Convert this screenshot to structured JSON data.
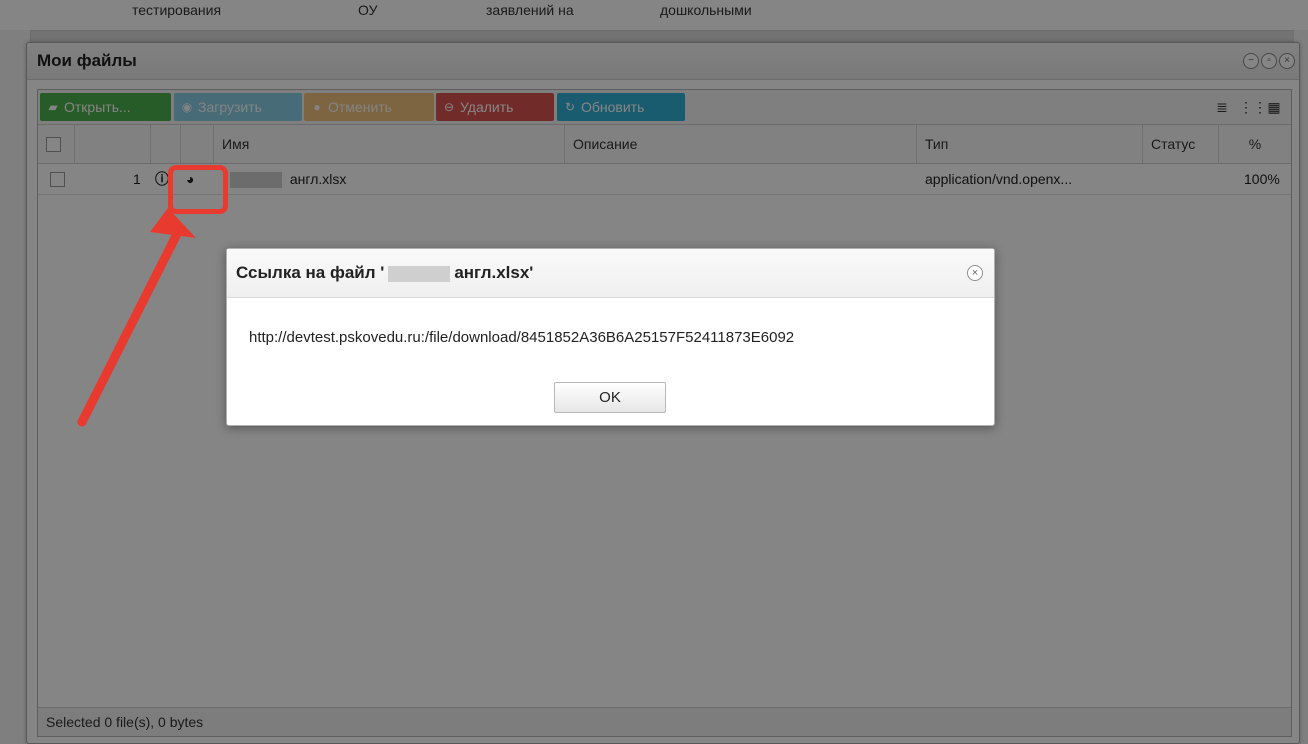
{
  "background": {
    "columns": [
      "тестирования",
      "ОУ",
      "заявлений на",
      "дошкольными"
    ]
  },
  "window": {
    "title": "Мои файлы"
  },
  "toolbar": {
    "open": "Открыть...",
    "upload": "Загрузить",
    "cancel": "Отменить",
    "delete": "Удалить",
    "refresh": "Обновить"
  },
  "grid": {
    "headers": {
      "name": "Имя",
      "description": "Описание",
      "type": "Тип",
      "status": "Статус",
      "percent": "%"
    },
    "rows": [
      {
        "index": "1",
        "name": "англ.xlsx",
        "description": "",
        "type": "application/vnd.openx...",
        "status": "",
        "percent": "100%"
      }
    ]
  },
  "statusbar": {
    "text": "Selected 0 file(s), 0 bytes"
  },
  "dialog": {
    "title_prefix": "Ссылка на файл '",
    "title_name": "англ.xlsx'",
    "url": "http://devtest.pskovedu.ru:/file/download/8451852A36B6A25157F52411873E6092",
    "ok": "OK"
  },
  "colors": {
    "open": "#4cae4c",
    "upload": "#5bc0de",
    "cancel": "#f0ad4e",
    "delete": "#d9534f",
    "refresh": "#31b0d5",
    "annotation": "#e83a2e"
  }
}
